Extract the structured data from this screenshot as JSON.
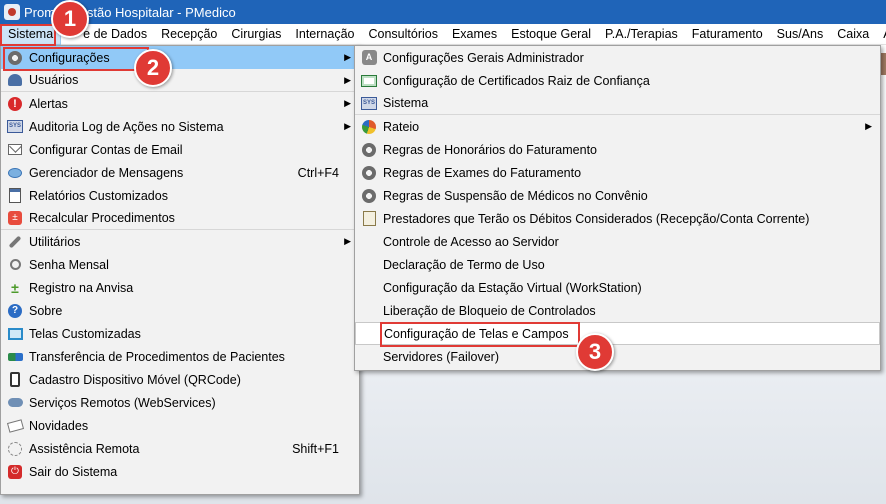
{
  "window": {
    "title": "Prom... Gestão Hospitalar - PMedico"
  },
  "menubar": {
    "items": [
      "Sistema",
      "e de Dados",
      "Recepção",
      "Cirurgias",
      "Internação",
      "Consultórios",
      "Exames",
      "Estoque Geral",
      "P.A./Terapias",
      "Faturamento",
      "Sus/Ans",
      "Caixa",
      "A"
    ]
  },
  "sistema_menu": {
    "items": [
      {
        "label": "Configurações",
        "icon": "gear-icon",
        "submenu": true
      },
      {
        "label": "Usuários",
        "icon": "users-icon",
        "submenu": true
      },
      {
        "label": "Alertas",
        "icon": "alert-icon",
        "submenu": true
      },
      {
        "label": "Auditoria Log de Ações no Sistema",
        "icon": "sys-icon",
        "submenu": true
      },
      {
        "label": "Configurar Contas de Email",
        "icon": "mail-icon"
      },
      {
        "label": "Gerenciador de Mensagens",
        "icon": "message-icon",
        "shortcut": "Ctrl+F4"
      },
      {
        "label": "Relatórios Customizados",
        "icon": "report-icon"
      },
      {
        "label": "Recalcular Procedimentos",
        "icon": "calculator-icon"
      },
      {
        "label": "Utilitários",
        "icon": "wrench-icon",
        "submenu": true
      },
      {
        "label": "Senha Mensal",
        "icon": "search-icon"
      },
      {
        "label": "Registro na Anvisa",
        "icon": "plus-icon"
      },
      {
        "label": "Sobre",
        "icon": "help-icon"
      },
      {
        "label": "Telas Customizadas",
        "icon": "screen-icon"
      },
      {
        "label": "Transferência de Procedimentos de Pacientes",
        "icon": "transfer-icon"
      },
      {
        "label": "Cadastro Dispositivo Móvel (QRCode)",
        "icon": "phone-icon"
      },
      {
        "label": "Serviços Remotos (WebServices)",
        "icon": "cloud-icon"
      },
      {
        "label": "Novidades",
        "icon": "news-icon"
      },
      {
        "label": "Assistência Remota",
        "icon": "remote-icon",
        "shortcut": "Shift+F1"
      },
      {
        "label": "Sair do Sistema",
        "icon": "exit-icon"
      }
    ]
  },
  "config_menu": {
    "items": [
      {
        "label": "Configurações Gerais Administrador",
        "icon": "admin-icon"
      },
      {
        "label": "Configuração de Certificados Raiz de Confiança",
        "icon": "certificate-icon"
      },
      {
        "label": "Sistema",
        "icon": "sys-icon"
      },
      {
        "label": "Rateio",
        "icon": "pie-icon",
        "submenu": true
      },
      {
        "label": "Regras de Honorários do Faturamento",
        "icon": "gear-icon"
      },
      {
        "label": "Regras de Exames do Faturamento",
        "icon": "gear-icon"
      },
      {
        "label": "Regras de Suspensão de Médicos no Convênio",
        "icon": "gear-icon"
      },
      {
        "label": "Prestadores que Terão os Débitos Considerados (Recepção/Conta Corrente)",
        "icon": "document-icon"
      },
      {
        "label": "Controle de Acesso ao Servidor"
      },
      {
        "label": "Declaração de Termo de Uso"
      },
      {
        "label": "Configuração da Estação Virtual (WorkStation)"
      },
      {
        "label": "Liberação de Bloqueio de Controlados"
      },
      {
        "label": "Configuração de Telas e Campos"
      },
      {
        "label": "Servidores (Failover)"
      }
    ]
  },
  "callouts": [
    "1",
    "2",
    "3"
  ],
  "colors": {
    "titlebar": "#1f64b8",
    "highlight": "#91c9f7",
    "callout": "#e03a35"
  }
}
